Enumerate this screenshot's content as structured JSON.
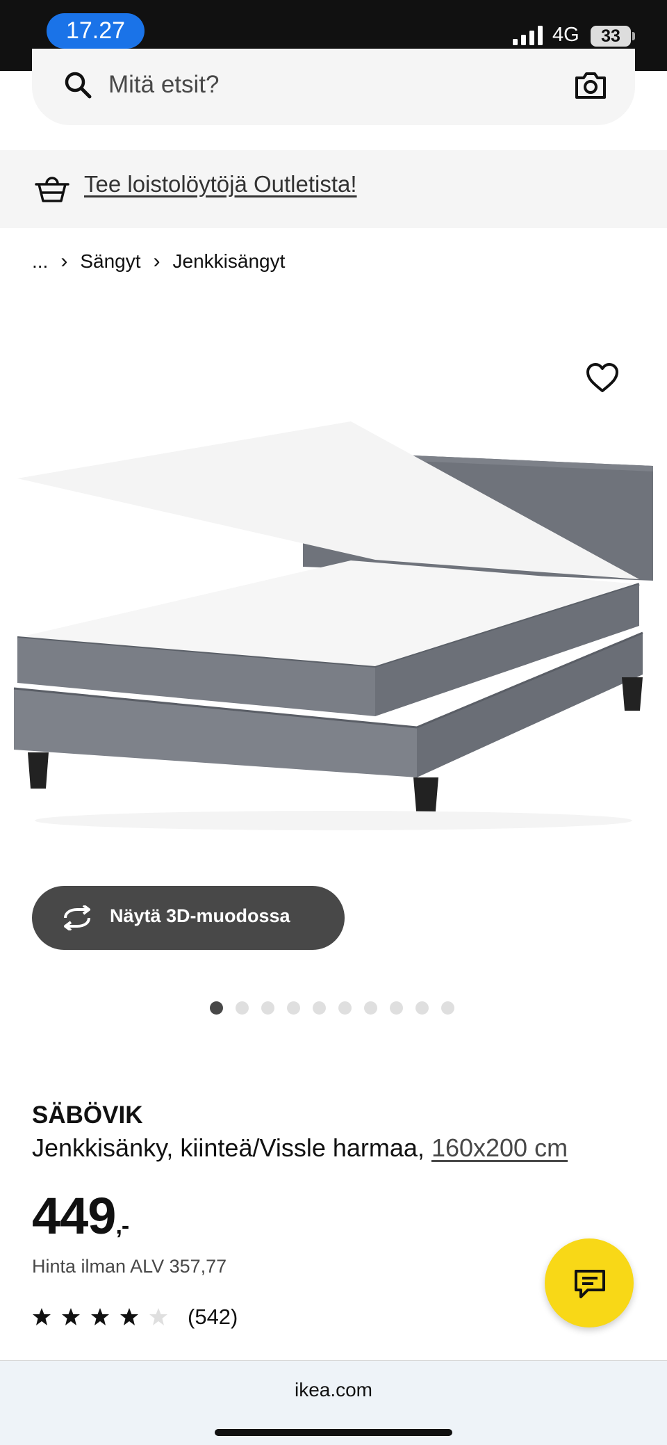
{
  "status_bar": {
    "time": "17.27",
    "network": "4G",
    "battery": "33"
  },
  "search": {
    "placeholder": "Mitä etsit?"
  },
  "outlet_banner": {
    "text": "Tee loistolöytöjä Outletista!"
  },
  "breadcrumb": {
    "ellipsis": "...",
    "items": [
      "Sängyt",
      "Jenkkisängyt"
    ],
    "separator": "›"
  },
  "gallery": {
    "view_3d_label": "Näytä 3D-muodossa",
    "dot_count": 10,
    "active_index": 0
  },
  "product": {
    "name": "SÄBÖVIK",
    "description": "Jenkkisänky, kiinteä/Vissle harmaa, ",
    "size_link": "160x200 cm",
    "price": "449",
    "price_suffix": ",-",
    "vat_price": "Hinta ilman ALV 357,77",
    "rating": {
      "value": 4,
      "max": 5,
      "count": "(542)"
    }
  },
  "browser": {
    "url": "ikea.com"
  },
  "colors": {
    "chat_button": "#f8d817",
    "dark_button": "#484848",
    "time_pill": "#1a73e8"
  }
}
